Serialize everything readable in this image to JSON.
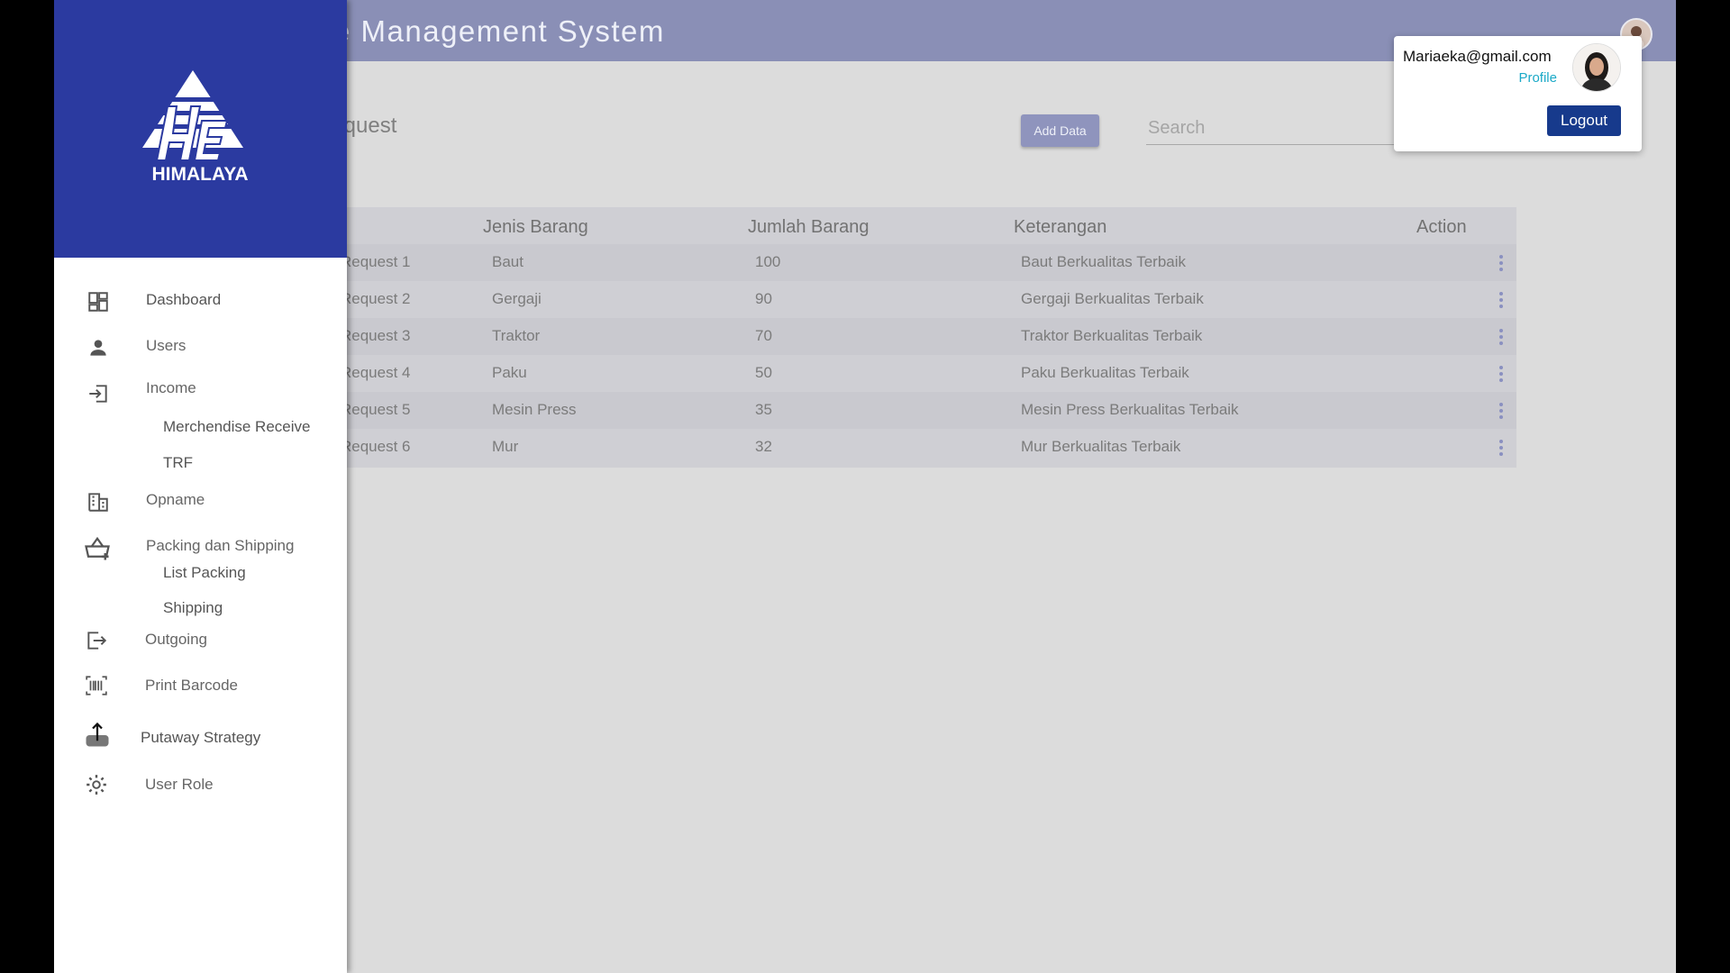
{
  "app": {
    "title": "e Management System"
  },
  "page": {
    "heading": "Request",
    "add_button": "Add Data",
    "search_placeholder": "Search"
  },
  "table": {
    "headers": [
      "Jenis Barang",
      "Jumlah Barang",
      "Keterangan",
      "Action"
    ],
    "rows": [
      {
        "request": "Request 1",
        "jenis": "Baut",
        "jumlah": "100",
        "keterangan": "Baut Berkualitas Terbaik"
      },
      {
        "request": "Request 2",
        "jenis": "Gergaji",
        "jumlah": "90",
        "keterangan": "Gergaji Berkualitas Terbaik"
      },
      {
        "request": "Request 3",
        "jenis": "Traktor",
        "jumlah": "70",
        "keterangan": "Traktor Berkualitas Terbaik"
      },
      {
        "request": "Request 4",
        "jenis": "Paku",
        "jumlah": "50",
        "keterangan": "Paku Berkualitas Terbaik"
      },
      {
        "request": "Request 5",
        "jenis": "Mesin Press",
        "jumlah": "35",
        "keterangan": "Mesin Press Berkualitas Terbaik"
      },
      {
        "request": "Request 6",
        "jenis": "Mur",
        "jumlah": "32",
        "keterangan": "Mur Berkualitas Terbaik"
      }
    ]
  },
  "sidebar": {
    "logo_text": "HIMALAYA",
    "items": [
      {
        "label": "Dashboard",
        "icon": "dashboard-icon"
      },
      {
        "label": "Users",
        "icon": "person-icon"
      },
      {
        "label": "Income",
        "icon": "login-icon",
        "children": [
          "Merchendise Receive",
          "TRF"
        ]
      },
      {
        "label": "Opname",
        "icon": "building-icon"
      },
      {
        "label": "Packing dan Shipping",
        "icon": "basket-plus-icon",
        "children": [
          "List Packing",
          "Shipping"
        ]
      },
      {
        "label": "Outgoing",
        "icon": "logout-icon"
      },
      {
        "label": "Print Barcode",
        "icon": "barcode-icon"
      },
      {
        "label": "Putaway Strategy",
        "icon": "upload-icon"
      },
      {
        "label": "User Role",
        "icon": "gear-icon"
      }
    ]
  },
  "user_menu": {
    "email": "Mariaeka@gmail.com",
    "profile_link": "Profile",
    "logout_label": "Logout"
  },
  "colors": {
    "sidebar_header": "#2b3aa0",
    "topbar": "#8a8fb6",
    "logout": "#173a8c",
    "profile_link": "#1aa9c7"
  }
}
